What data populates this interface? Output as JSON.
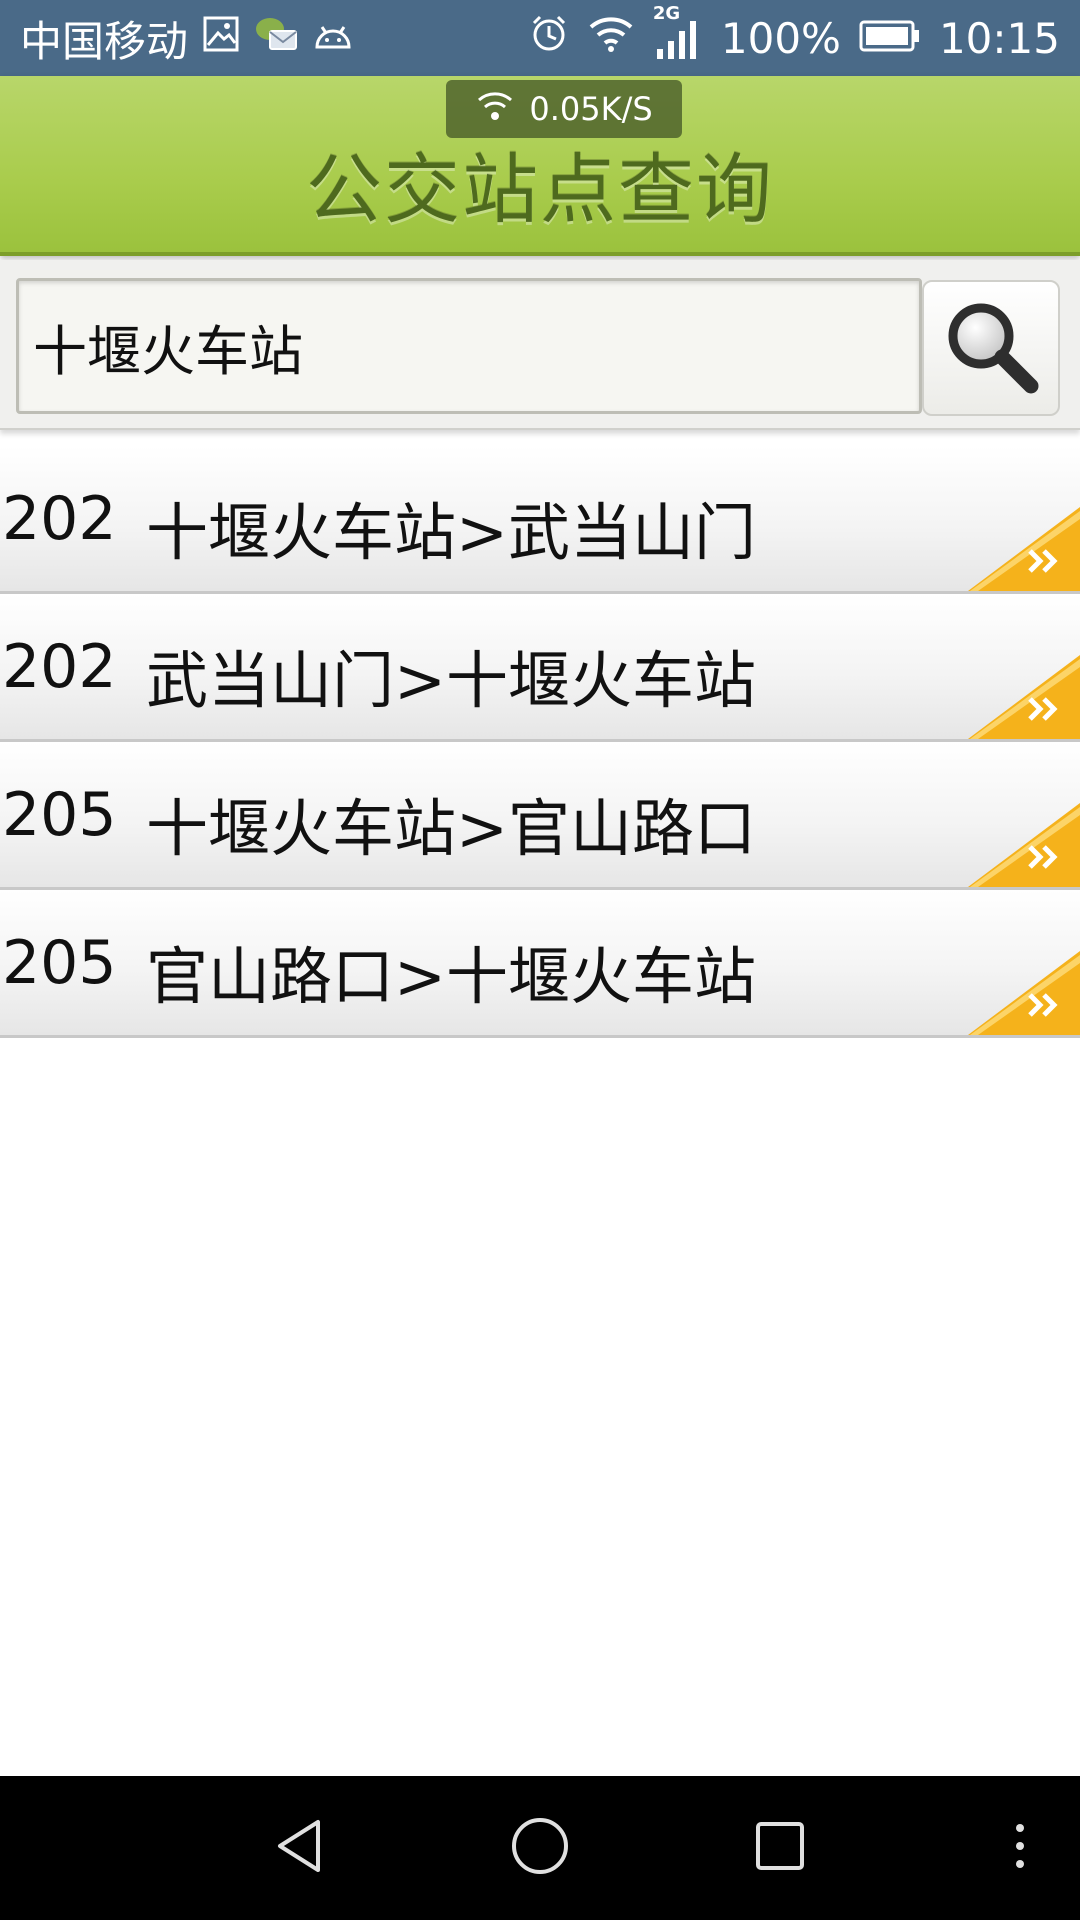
{
  "status_bar": {
    "carrier": "中国移动",
    "network_type": "2G",
    "battery": "100%",
    "time": "10:15",
    "icons": [
      "gallery-icon",
      "message-notification-icon",
      "android-icon",
      "alarm-icon",
      "wifi-icon",
      "signal-icon",
      "battery-icon"
    ]
  },
  "network_toast": {
    "speed": "0.05K/S",
    "icon": "wifi-icon"
  },
  "header": {
    "title": "公交站点查询",
    "color": "#a9cc4c"
  },
  "search": {
    "value": "十堰火车站",
    "button_icon": "search-icon"
  },
  "results": [
    {
      "route": "202",
      "direction": "十堰火车站>武当山门"
    },
    {
      "route": "202",
      "direction": "武当山门>十堰火车站"
    },
    {
      "route": "205",
      "direction": "十堰火车站>官山路口"
    },
    {
      "route": "205",
      "direction": "官山路口>十堰火车站"
    }
  ],
  "accent_color": "#f5b21b",
  "nav_bar": {
    "buttons": [
      "back-icon",
      "home-icon",
      "recents-icon",
      "menu-icon"
    ]
  }
}
